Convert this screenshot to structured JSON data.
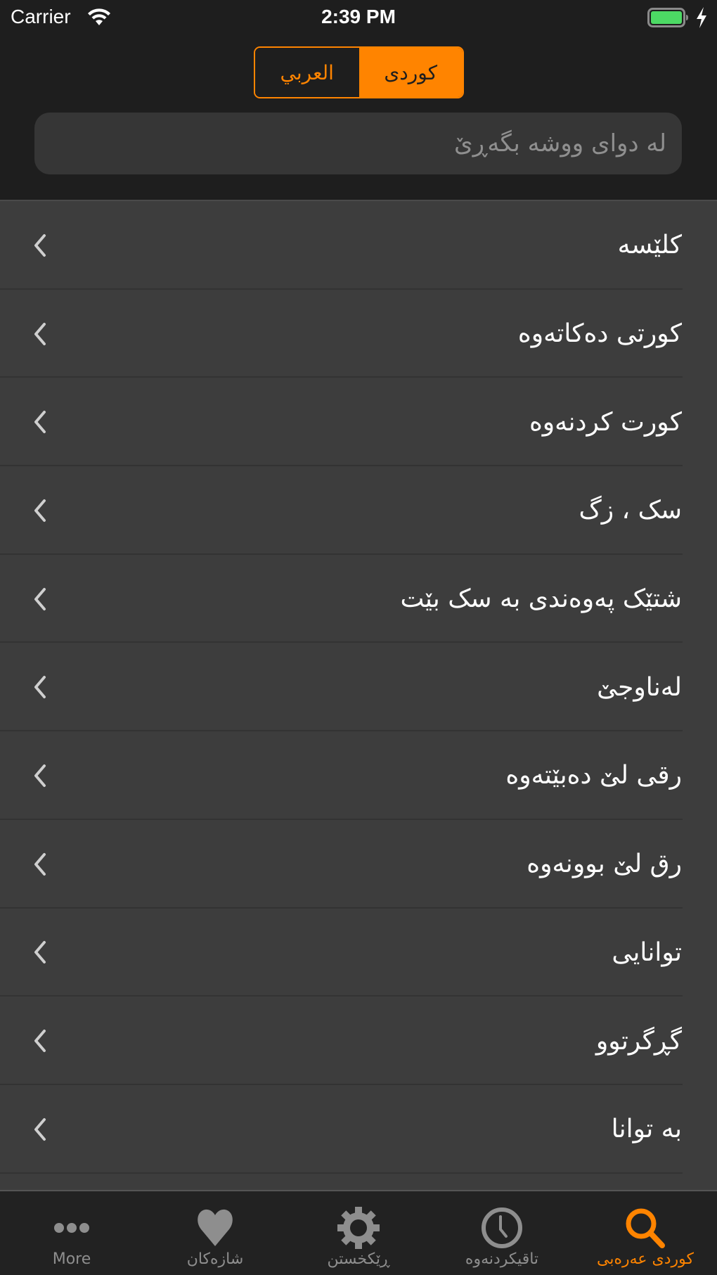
{
  "status_bar": {
    "carrier": "Carrier",
    "time": "2:39 PM",
    "battery_level": 1.0,
    "charging": true
  },
  "colors": {
    "accent": "#ff8400",
    "background": "#1e1e1e",
    "list_background": "#3d3d3d",
    "search_background": "#363636",
    "battery_green": "#4cd964",
    "inactive_icon": "#8e8e8e"
  },
  "language_selector": {
    "options": [
      {
        "label": "العربي",
        "selected": false
      },
      {
        "label": "كوردی",
        "selected": true
      }
    ]
  },
  "search": {
    "placeholder": "له دوای ووشه بگەڕێ",
    "value": ""
  },
  "results": [
    {
      "label": "کلێسه",
      "icon": "chevron-left-icon"
    },
    {
      "label": "کورتی دەکاتەوە",
      "icon": "chevron-left-icon"
    },
    {
      "label": "کورت کردنەوە",
      "icon": "chevron-left-icon"
    },
    {
      "label": "سک ، زگ",
      "icon": "chevron-left-icon"
    },
    {
      "label": "شتێک پەوەندی به سک بێت",
      "icon": "chevron-left-icon"
    },
    {
      "label": "لەناوجێ",
      "icon": "chevron-left-icon"
    },
    {
      "label": "رقی لێ دەبێتەوە",
      "icon": "chevron-left-icon"
    },
    {
      "label": "رق لێ بوونەوە",
      "icon": "chevron-left-icon"
    },
    {
      "label": "توانایی",
      "icon": "chevron-left-icon"
    },
    {
      "label": "گڕگرتوو",
      "icon": "chevron-left-icon"
    },
    {
      "label": "به توانا",
      "icon": "chevron-left-icon"
    }
  ],
  "tab_bar": {
    "tabs": [
      {
        "label": "More",
        "icon": "more-dots-icon",
        "active": false
      },
      {
        "label": "شازەکان",
        "icon": "heart-icon",
        "active": false
      },
      {
        "label": "ڕێکخستن",
        "icon": "gear-icon",
        "active": false
      },
      {
        "label": "تاقیکردنەوە",
        "icon": "clock-icon",
        "active": false
      },
      {
        "label": "کوردی عەرەبی",
        "icon": "search-icon",
        "active": true
      }
    ]
  }
}
